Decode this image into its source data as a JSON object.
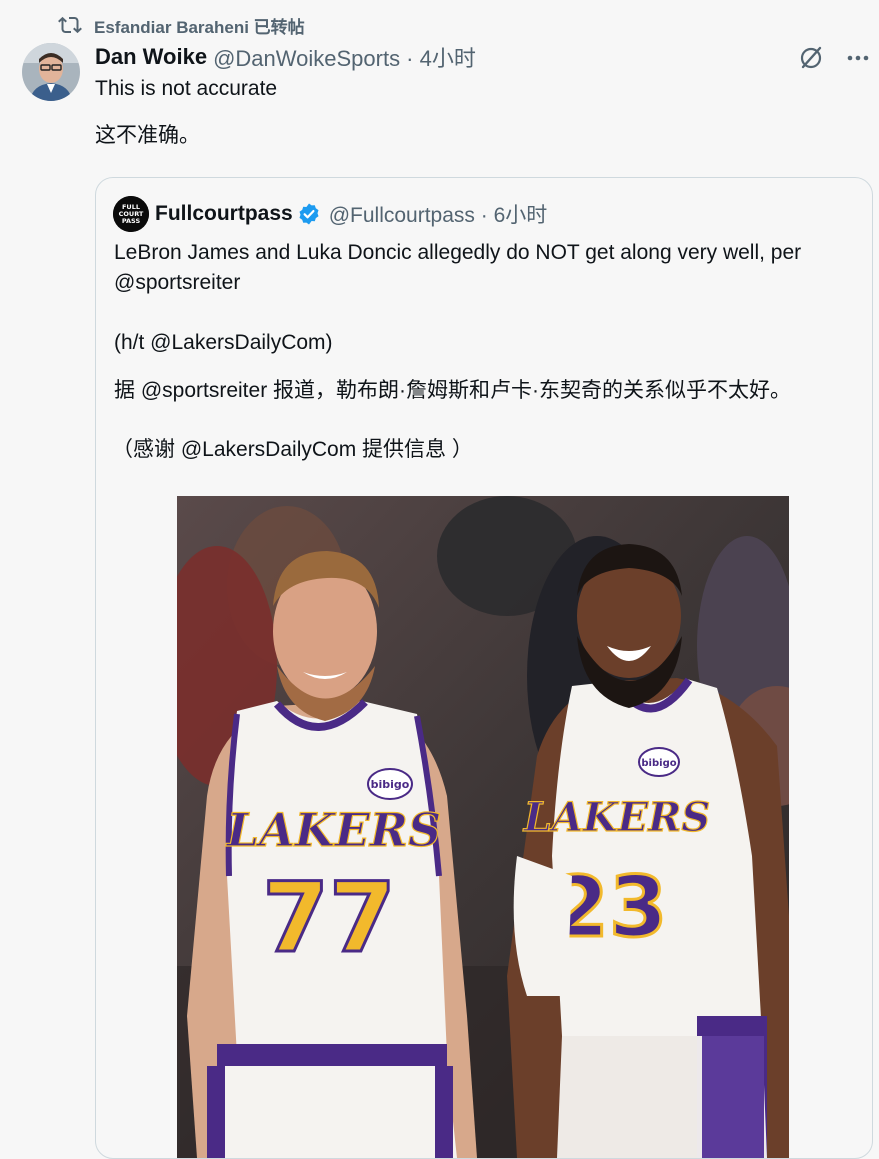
{
  "repost": {
    "text": "Esfandiar Baraheni 已转帖"
  },
  "tweet": {
    "author_name": "Dan Woike",
    "handle_time": "@DanWoikeSports · 4小时",
    "text": "This is not accurate",
    "translation": "这不准确。"
  },
  "quote": {
    "author_name": "Fullcourtpass",
    "handle_time": "@Fullcourtpass · 6小时",
    "logo_text": [
      "FULL",
      "COURT",
      "PASS"
    ],
    "lines": [
      "LeBron James and Luka Doncic allegedly do NOT get along very well, per",
      "@sportsreiter",
      "(h/t @LakersDailyCom)",
      "据 @sportsreiter 报道，勒布朗·詹姆斯和卢卡·东契奇的关系似乎不太好。",
      "（感谢 @LakersDailyCom 提供信息 ）"
    ],
    "photo": {
      "left_jersey": {
        "team": "LAKERS",
        "number": "77",
        "sponsor": "bibigo"
      },
      "right_jersey": {
        "team": "LAKERS",
        "number": "23",
        "sponsor": "bibigo"
      }
    }
  },
  "icons": {
    "repost": "repost-icon",
    "grok": "grok-icon",
    "more": "more-icon",
    "verified": "verified-badge-icon"
  },
  "colors": {
    "accent": "#1d9bf0",
    "muted": "#536471",
    "jersey_purple": "#4a2a86",
    "jersey_gold": "#f2b92c"
  }
}
